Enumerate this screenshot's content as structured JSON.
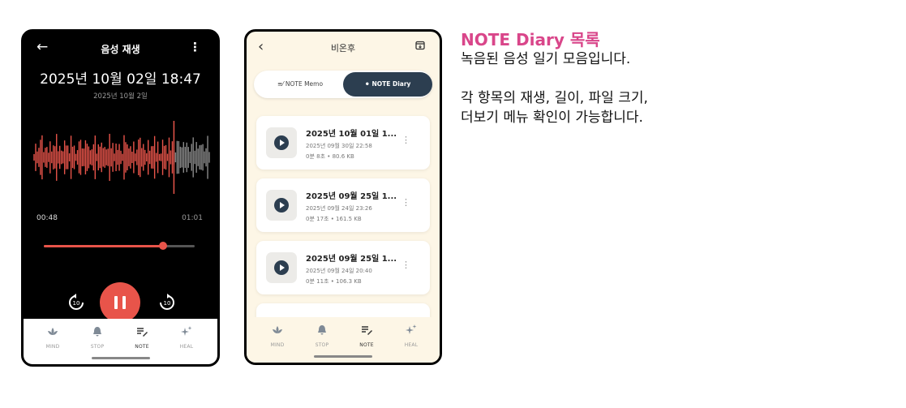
{
  "colors": {
    "accent": "#e8544a",
    "dark": "#2c3e50",
    "heading": "#d9468a",
    "cream": "#fdf6e6"
  },
  "player": {
    "title": "음성 재생",
    "datetime": "2025년 10월 02일 18:47",
    "date_sub": "2025년 10월 2일",
    "current_time": "00:48",
    "total_time": "01:01",
    "progress": 0.79,
    "skip_back": "10",
    "skip_forward": "10",
    "back_icon": "arrow-left-icon",
    "more_icon": "more-vertical-icon"
  },
  "tabs": [
    {
      "label": "MIND",
      "icon": "lotus-icon"
    },
    {
      "label": "STOP",
      "icon": "bell-icon"
    },
    {
      "label": "NOTE",
      "icon": "note-pen-icon"
    },
    {
      "label": "HEAL",
      "icon": "sparkle-icon"
    }
  ],
  "list_screen": {
    "title": "비온후",
    "segment": {
      "memo": "NOTE Memo",
      "diary": "NOTE Diary"
    },
    "items": [
      {
        "title": "2025년 10월 01일 1...",
        "date": "2025년 09월 30일 22:58",
        "meta": "0분 8초 • 80.6 KB"
      },
      {
        "title": "2025년 09월 25일 1...",
        "date": "2025년 09월 24일 23:26",
        "meta": "0분 17초 • 161.5 KB"
      },
      {
        "title": "2025년 09월 25일 1...",
        "date": "2025년 09월 24일 20:40",
        "meta": "0분 11초 • 106.3 KB"
      }
    ]
  },
  "description": {
    "heading": "NOTE Diary 목록",
    "line1": "녹음된 음성 일기 모음입니다.",
    "line2": "각 항목의 재생, 길이, 파일 크기,",
    "line3": "더보기 메뉴 확인이 가능합니다."
  }
}
